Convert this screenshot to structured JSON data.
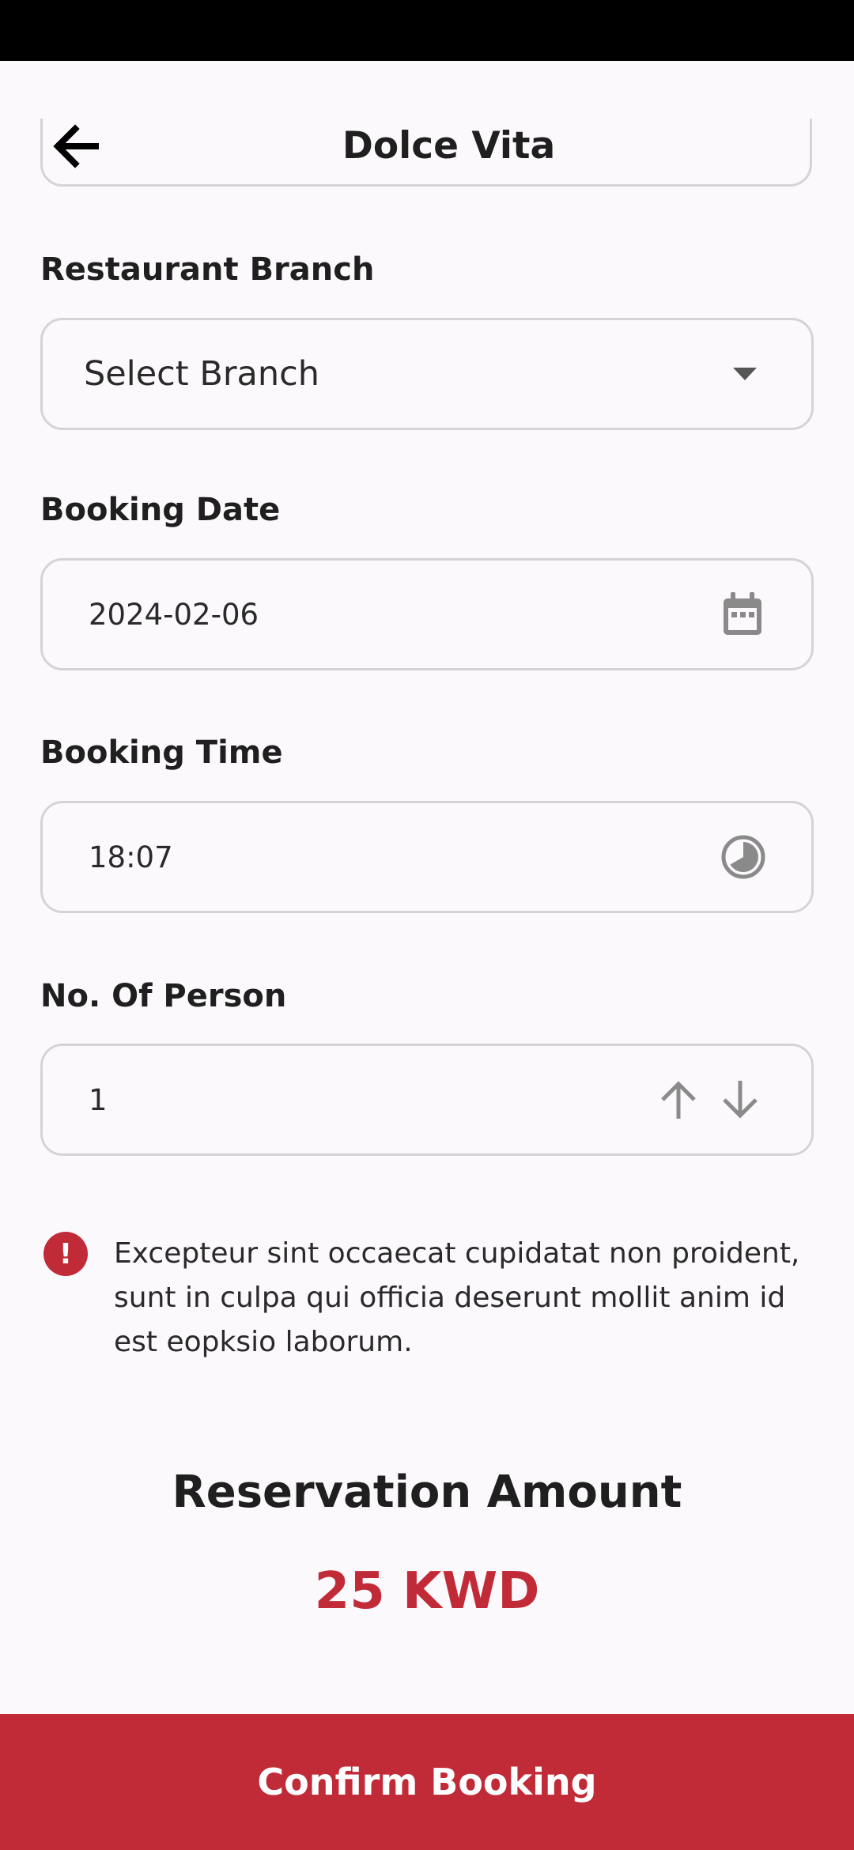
{
  "header": {
    "title": "Dolce Vita",
    "back_icon": "arrow-left-icon"
  },
  "form": {
    "branch": {
      "label": "Restaurant Branch",
      "value": "Select Branch",
      "icon": "chevron-down-icon"
    },
    "date": {
      "label": "Booking Date",
      "value": "2024-02-06",
      "icon": "calendar-icon"
    },
    "time": {
      "label": "Booking Time",
      "value": "18:07",
      "icon": "clock-icon"
    },
    "persons": {
      "label": "No. Of Person",
      "value": "1",
      "increment_icon": "arrow-up-icon",
      "decrement_icon": "arrow-down-icon"
    }
  },
  "notice": {
    "icon": "error-icon",
    "text": "Excepteur sint occaecat cupidatat non proident, sunt in culpa qui officia deserunt mollit anim id est eopksio laborum."
  },
  "reservation": {
    "label": "Reservation Amount",
    "amount": "25 KWD"
  },
  "confirm_button": {
    "label": "Confirm Booking"
  },
  "colors": {
    "accent": "#c12b38",
    "background": "#fcf9fc",
    "border": "#d6d2d6",
    "icon_gray": "#8a8a8a"
  }
}
